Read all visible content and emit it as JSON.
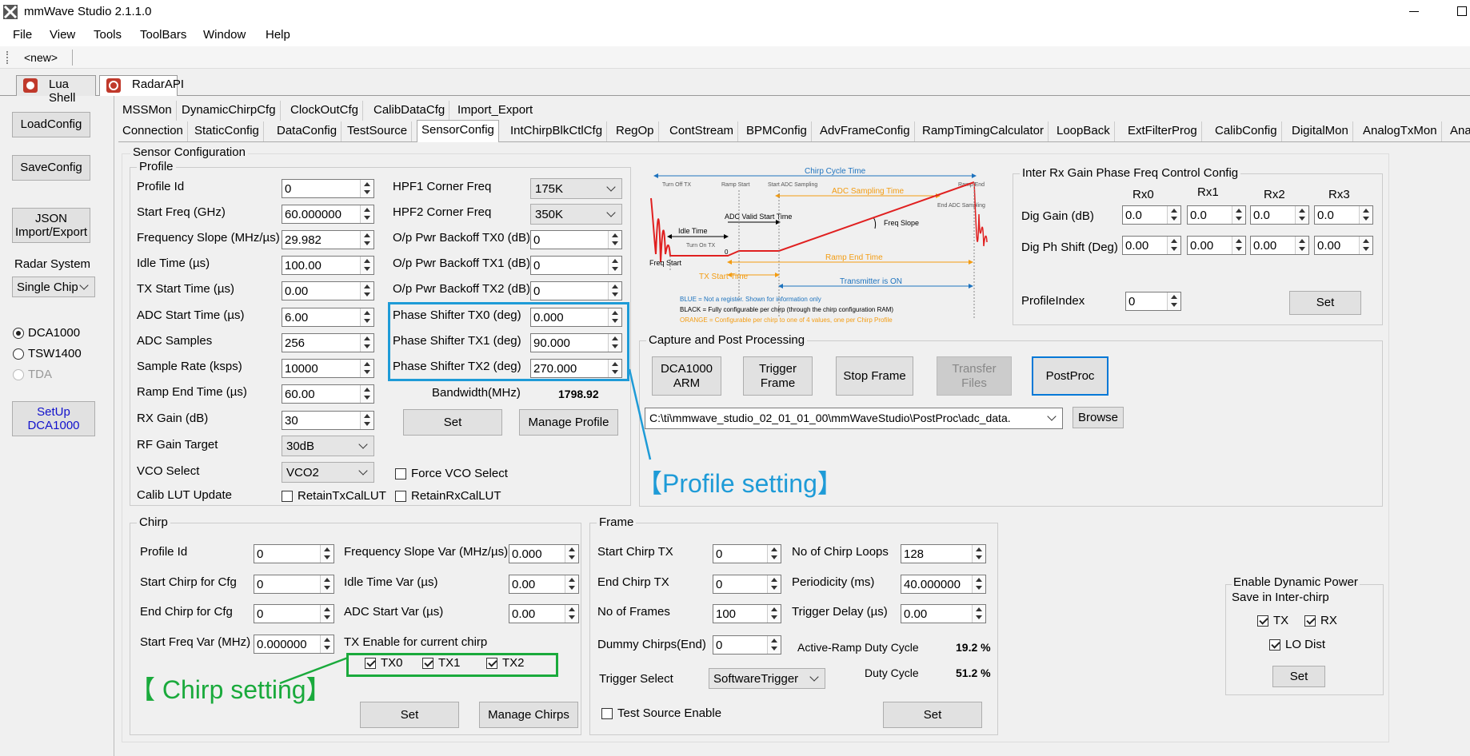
{
  "window": {
    "title": "mmWave Studio 2.1.1.0"
  },
  "menu": [
    "File",
    "View",
    "Tools",
    "ToolBars",
    "Window",
    "Help"
  ],
  "toolbar": {
    "doc": "<new>"
  },
  "doc_tabs": [
    "Lua Shell",
    "RadarAPI"
  ],
  "left": {
    "load": "LoadConfig",
    "save": "SaveConfig",
    "json1": "JSON",
    "json2": "Import/Export",
    "radar_system_label": "Radar System",
    "radar_system_value": "Single Chip",
    "radio": [
      "DCA1000",
      "TSW1400",
      "TDA"
    ],
    "setup1": "SetUp",
    "setup2": "DCA1000"
  },
  "tabs_row1": [
    "MSSMon",
    "DynamicChirpCfg",
    "ClockOutCfg",
    "CalibDataCfg",
    "Import_Export"
  ],
  "tabs_row2": [
    "Connection",
    "StaticConfig",
    "DataConfig",
    "TestSource",
    "SensorConfig",
    "IntChirpBlkCtlCfg",
    "RegOp",
    "ContStream",
    "BPMConfig",
    "AdvFrameConfig",
    "RampTimingCalculator",
    "LoopBack",
    "ExtFilterProg",
    "CalibConfig",
    "DigitalMon",
    "AnalogTxMon",
    "Analo"
  ],
  "sensor": {
    "title": "Sensor Configuration"
  },
  "profile": {
    "title": "Profile",
    "fields": [
      {
        "label": "Profile Id",
        "value": "0"
      },
      {
        "label": "Start Freq (GHz)",
        "value": "60.000000"
      },
      {
        "label": "Frequency Slope (MHz/µs)",
        "value": "29.982"
      },
      {
        "label": "Idle Time (µs)",
        "value": "100.00"
      },
      {
        "label": "TX Start Time (µs)",
        "value": "0.00"
      },
      {
        "label": "ADC Start Time (µs)",
        "value": "6.00"
      },
      {
        "label": "ADC Samples",
        "value": "256"
      },
      {
        "label": "Sample Rate (ksps)",
        "value": "10000"
      },
      {
        "label": "Ramp End Time (µs)",
        "value": "60.00"
      },
      {
        "label": "RX Gain (dB)",
        "value": "30"
      }
    ],
    "rf_gain_label": "RF Gain Target",
    "rf_gain_value": "30dB",
    "vco_label": "VCO Select",
    "vco_value": "VCO2",
    "calib_label": "Calib LUT Update",
    "retain_tx": "RetainTxCalLUT",
    "retain_rx": "RetainRxCalLUT",
    "force_vco": "Force VCO Select",
    "hpf1_label": "HPF1 Corner Freq",
    "hpf1_value": "175K",
    "hpf2_label": "HPF2 Corner Freq",
    "hpf2_value": "350K",
    "backoff": [
      {
        "label": "O/p Pwr Backoff TX0 (dB)",
        "value": "0"
      },
      {
        "label": "O/p Pwr Backoff TX1 (dB)",
        "value": "0"
      },
      {
        "label": "O/p Pwr Backoff TX2 (dB)",
        "value": "0"
      }
    ],
    "phase": [
      {
        "label": "Phase Shifter TX0 (deg)",
        "value": "0.000"
      },
      {
        "label": "Phase Shifter TX1 (deg)",
        "value": "90.000"
      },
      {
        "label": "Phase Shifter TX2 (deg)",
        "value": "270.000"
      }
    ],
    "bandwidth_label": "Bandwidth(MHz)",
    "bandwidth_value": "1798.92",
    "set": "Set",
    "manage": "Manage Profile"
  },
  "diagram": {
    "chirp_cycle": "Chirp Cycle Time",
    "turn_off": "Turn Off TX",
    "ramp_start": "Ramp Start",
    "start_adc": "Start ADC Sampling",
    "ramp_end": "Ramp End",
    "adc_sampling": "ADC Sampling Time",
    "end_adc": "End ADC Sampling",
    "adc_valid": "ADC Valid Start Time",
    "idle": "Idle Time",
    "freq_slope": "Freq Slope",
    "turn_on": "Turn On TX",
    "freq_start": "Freq Start",
    "zero": "0",
    "ramp_end_time": "Ramp End Time",
    "tx_start": "TX Start Time",
    "tx_on": "Transmitter is ON",
    "note_blue": "BLUE = Not a register. Shown for information only",
    "note_black": "BLACK = Fully configurable per chirp (through the chirp configuration RAM)",
    "note_orange": "ORANGE = Configurable per chirp to one of 4 values, one per Chirp Profile"
  },
  "gain": {
    "title": "Inter Rx Gain Phase Freq Control Config",
    "cols": [
      "Rx0",
      "Rx1",
      "Rx2",
      "Rx3"
    ],
    "dig_gain_label": "Dig Gain (dB)",
    "dig_gain": [
      "0.0",
      "0.0",
      "0.0",
      "0.0"
    ],
    "dig_ph_label": "Dig Ph Shift (Deg)",
    "dig_ph": [
      "0.00",
      "0.00",
      "0.00",
      "0.00"
    ],
    "profile_index_label": "ProfileIndex",
    "profile_index": "0",
    "set": "Set"
  },
  "capture": {
    "title": "Capture and Post Processing",
    "dca_arm1": "DCA1000",
    "dca_arm2": "ARM",
    "trigger1": "Trigger",
    "trigger2": "Frame",
    "stop": "Stop Frame",
    "transfer1": "Transfer",
    "transfer2": "Files",
    "postproc": "PostProc",
    "path": "C:\\ti\\mmwave_studio_02_01_01_00\\mmWaveStudio\\PostProc\\adc_data.",
    "browse": "Browse"
  },
  "annot": {
    "profile": "【Profile setting】",
    "chirp": "【 Chirp setting】"
  },
  "chirp": {
    "title": "Chirp",
    "left": [
      {
        "label": "Profile Id",
        "value": "0"
      },
      {
        "label": "Start Chirp for Cfg",
        "value": "0"
      },
      {
        "label": "End Chirp for Cfg",
        "value": "0"
      },
      {
        "label": "Start Freq Var (MHz)",
        "value": "0.000000"
      }
    ],
    "right": [
      {
        "label": "Frequency Slope Var (MHz/µs)",
        "value": "0.000"
      },
      {
        "label": "Idle Time Var (µs)",
        "value": "0.00"
      },
      {
        "label": "ADC Start Var (µs)",
        "value": "0.00"
      }
    ],
    "tx_enable": "TX Enable for current chirp",
    "tx": [
      "TX0",
      "TX1",
      "TX2"
    ],
    "set": "Set",
    "manage": "Manage Chirps"
  },
  "frame": {
    "title": "Frame",
    "left": [
      {
        "label": "Start Chirp TX",
        "value": "0"
      },
      {
        "label": "End Chirp TX",
        "value": "0"
      },
      {
        "label": "No of Frames",
        "value": "100"
      },
      {
        "label": "Dummy Chirps(End)",
        "value": "0"
      }
    ],
    "right": [
      {
        "label": "No of Chirp Loops",
        "value": "128"
      },
      {
        "label": "Periodicity (ms)",
        "value": "40.000000"
      },
      {
        "label": "Trigger Delay (µs)",
        "value": "0.00"
      }
    ],
    "active_label": "Active-Ramp Duty Cycle",
    "active_value": "19.2 %",
    "duty_label": "Duty Cycle",
    "duty_value": "51.2 %",
    "trigger_label": "Trigger Select",
    "trigger_value": "SoftwareTrigger",
    "test_source": "Test Source Enable",
    "set": "Set"
  },
  "dyn": {
    "title1": "Enable Dynamic Power",
    "title2": "Save in Inter-chirp",
    "tx": "TX",
    "rx": "RX",
    "lo": "LO Dist",
    "set": "Set"
  },
  "colors": {
    "annot_blue": "#1e9bd7",
    "annot_green": "#1aaa3c",
    "accent": "#0078d7"
  }
}
